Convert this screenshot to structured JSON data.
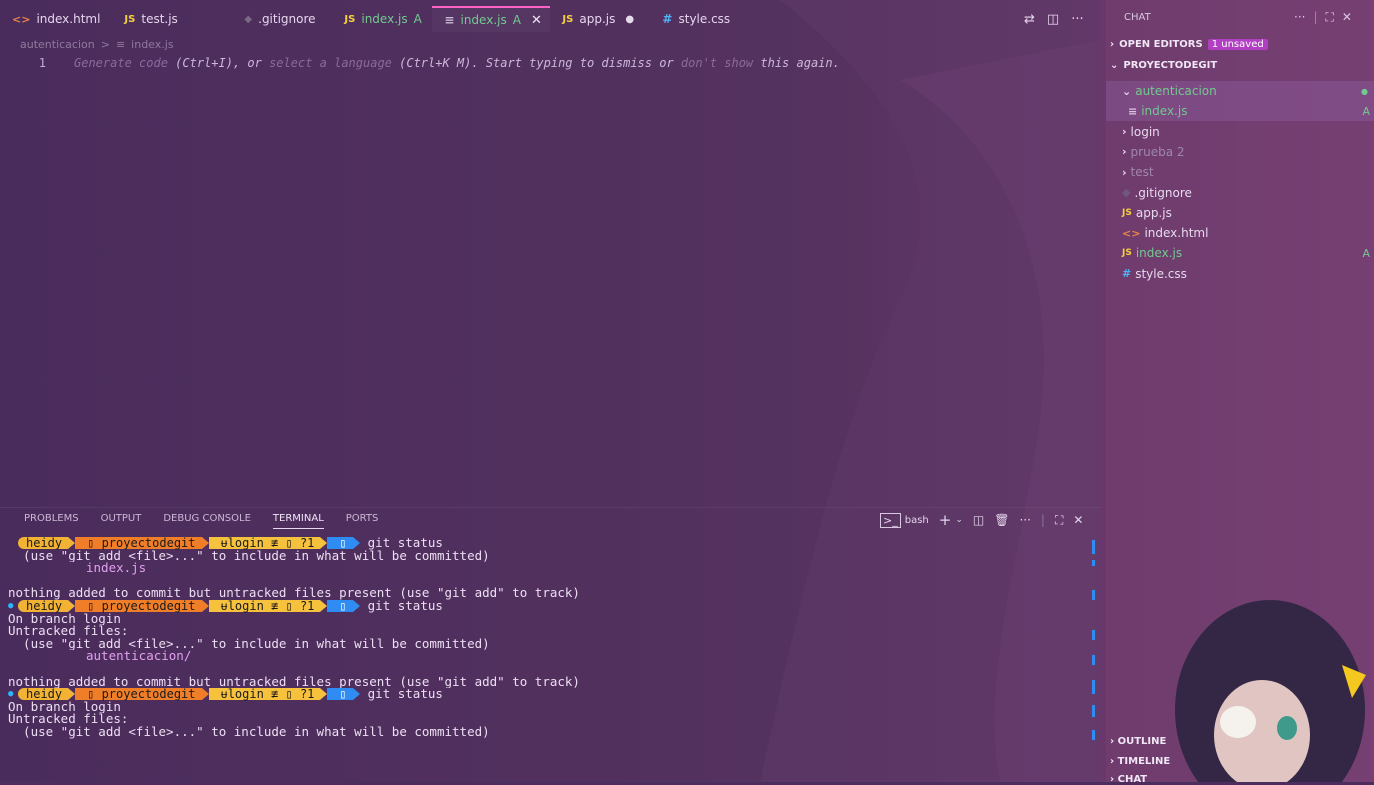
{
  "tabs": [
    {
      "label": "index.html",
      "icon": "html-icon",
      "glyph": "<>",
      "state": "normal"
    },
    {
      "label": "test.js",
      "icon": "js-icon",
      "glyph": "JS",
      "state": "normal"
    },
    {
      "label": ".gitignore",
      "icon": "git-icon",
      "glyph": "◆",
      "state": "dim"
    },
    {
      "label": "index.js",
      "icon": "js-icon",
      "glyph": "JS",
      "state": "git-a",
      "badge": "A"
    },
    {
      "label": "index.js",
      "icon": "text-file-icon",
      "glyph": "≡",
      "state": "active",
      "badge": "A"
    },
    {
      "label": "app.js",
      "icon": "js-icon",
      "glyph": "JS",
      "state": "modified"
    },
    {
      "label": "style.css",
      "icon": "css-icon",
      "glyph": "#",
      "state": "normal"
    }
  ],
  "breadcrumb": {
    "folder": "autenticacion",
    "separator": ">",
    "file": "index.js"
  },
  "editor": {
    "line_number": "1",
    "hint_1": "Generate code",
    "hint_2": " (Ctrl+I), or ",
    "hint_3": "select a language",
    "hint_4": " (Ctrl+K M). Start typing to dismiss or ",
    "hint_5": "don't show",
    "hint_6": " this again."
  },
  "panel": {
    "tabs": [
      "PROBLEMS",
      "OUTPUT",
      "DEBUG CONSOLE",
      "TERMINAL",
      "PORTS"
    ],
    "active_tab": "TERMINAL",
    "shell_label": "bash"
  },
  "prompt": {
    "user": "heidy",
    "repo": "▯ proyectodegit",
    "branch": "ᵾlogin ≢ ▯ ?1",
    "status": "▯"
  },
  "terminal": [
    {
      "type": "prompt",
      "dot": false,
      "cmd": "git status"
    },
    {
      "type": "text",
      "text": "  (use \"git add <file>...\" to include in what will be committed)"
    },
    {
      "type": "file",
      "text": "index.js"
    },
    {
      "type": "text",
      "text": ""
    },
    {
      "type": "text",
      "text": "nothing added to commit but untracked files present (use \"git add\" to track)"
    },
    {
      "type": "prompt",
      "dot": true,
      "cmd": "git status"
    },
    {
      "type": "text",
      "text": "On branch login"
    },
    {
      "type": "text",
      "text": "Untracked files:"
    },
    {
      "type": "text",
      "text": "  (use \"git add <file>...\" to include in what will be committed)"
    },
    {
      "type": "file",
      "text": "autenticacion/"
    },
    {
      "type": "text",
      "text": ""
    },
    {
      "type": "text",
      "text": "nothing added to commit but untracked files present (use \"git add\" to track)"
    },
    {
      "type": "prompt",
      "dot": true,
      "cmd": "git status"
    },
    {
      "type": "text",
      "text": "On branch login"
    },
    {
      "type": "text",
      "text": "Untracked files:"
    },
    {
      "type": "text",
      "text": "  (use \"git add <file>...\" to include in what will be committed)"
    }
  ],
  "sidebar": {
    "title": "CHAT",
    "open_editors": "OPEN EDITORS",
    "unsaved_badge": "1 unsaved",
    "project": "PROYECTODEGIT",
    "items": [
      {
        "label": "autenticacion",
        "kind": "folder-open",
        "depth": 1,
        "color": "green",
        "selected": true,
        "badge": "dot"
      },
      {
        "label": "index.js",
        "kind": "text-file",
        "depth": 2,
        "color": "green",
        "selected": true,
        "badge": "A"
      },
      {
        "label": "login",
        "kind": "folder",
        "depth": 1,
        "color": "normal"
      },
      {
        "label": "prueba 2",
        "kind": "folder",
        "depth": 1,
        "color": "dim"
      },
      {
        "label": "test",
        "kind": "folder",
        "depth": 1,
        "color": "dim"
      },
      {
        "label": ".gitignore",
        "kind": "git",
        "depth": 1,
        "color": "normal"
      },
      {
        "label": "app.js",
        "kind": "js",
        "depth": 1,
        "color": "normal"
      },
      {
        "label": "index.html",
        "kind": "html",
        "depth": 1,
        "color": "normal"
      },
      {
        "label": "index.js",
        "kind": "js",
        "depth": 1,
        "color": "green",
        "badge": "A"
      },
      {
        "label": "style.css",
        "kind": "css",
        "depth": 1,
        "color": "normal"
      }
    ],
    "bottom_sections": [
      "OUTLINE",
      "TIMELINE",
      "CHAT"
    ]
  },
  "colors": {
    "background": "#4b2d5e",
    "accent": "#ff63c3",
    "git_added": "#73c991",
    "prompt_blue": "#2f8cf2"
  }
}
